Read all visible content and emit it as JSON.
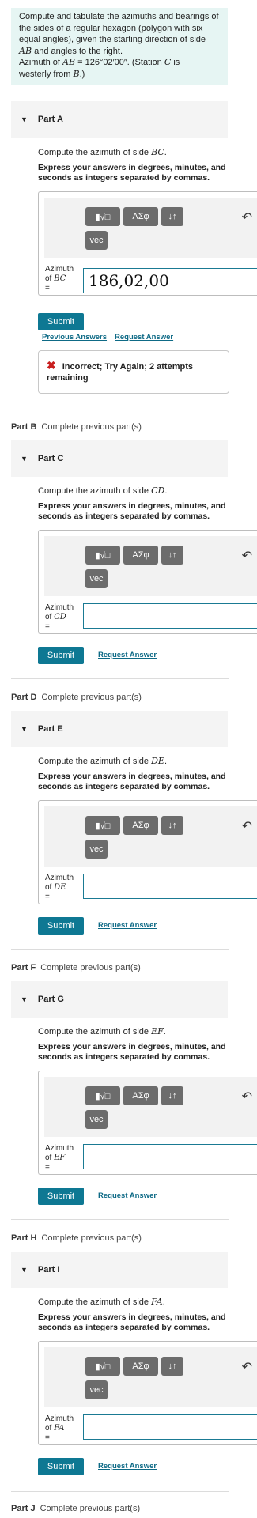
{
  "intro": {
    "line1": "Compute and tabulate the azimuths and bearings of",
    "line2": "the sides of a regular hexagon (polygon with six",
    "line3": "equal angles), given the starting direction of side",
    "line4_math": "AB",
    "line4_text": " and angles to the right.",
    "line5_pre": "Azimuth of ",
    "line5_math": "AB",
    "line5_post": " = 126°02′00″. (Station ",
    "line5_station": "C",
    "line5_end": " is",
    "line6_pre": "westerly from ",
    "line6_math": "B",
    "line6_end": ".)"
  },
  "common": {
    "instruction": "Express your answers in degrees, minutes, and seconds as integers separated by commas.",
    "compute_prefix": "Compute the azimuth of side ",
    "azimuth_label": "Azimuth",
    "of_label": "of",
    "eq_label": "=",
    "submit_label": "Submit",
    "request_answer": "Request Answer",
    "previous_answers": "Previous Answers",
    "tool_templates": "▮√□",
    "tool_greek": "ΑΣφ",
    "tool_arrows": "↓↑",
    "tool_vec": "vec",
    "undo": "↶"
  },
  "parts": [
    {
      "title": "Part A",
      "side": "BC",
      "value": "186,02,00"
    },
    {
      "title": "Part C",
      "side": "CD",
      "value": ""
    },
    {
      "title": "Part E",
      "side": "DE",
      "value": ""
    },
    {
      "title": "Part G",
      "side": "EF",
      "value": ""
    },
    {
      "title": "Part I",
      "side": "FA",
      "value": ""
    }
  ],
  "feedback": {
    "text": "Incorrect; Try Again; 2 attempts remaining"
  },
  "locked": [
    {
      "label": "Part B",
      "text": "Complete previous part(s)"
    },
    {
      "label": "Part D",
      "text": "Complete previous part(s)"
    },
    {
      "label": "Part F",
      "text": "Complete previous part(s)"
    },
    {
      "label": "Part H",
      "text": "Complete previous part(s)"
    },
    {
      "label": "Part J",
      "text": "Complete previous part(s)"
    }
  ]
}
